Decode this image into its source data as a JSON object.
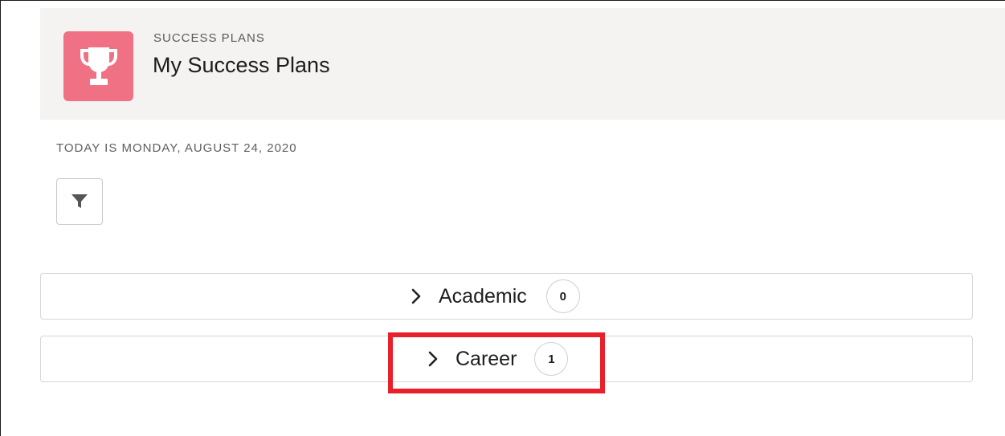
{
  "colors": {
    "app_icon_bg": "#f07183",
    "header_bg": "#f4f3f2",
    "highlight": "#e8202c"
  },
  "header": {
    "icon": "trophy-icon",
    "eyebrow": "SUCCESS PLANS",
    "title": "My Success Plans"
  },
  "today_text": "TODAY IS MONDAY, AUGUST 24, 2020",
  "filter_button": {
    "icon": "filter-icon"
  },
  "sections": [
    {
      "label": "Academic",
      "count": "0",
      "icon": "chevron-right-icon"
    },
    {
      "label": "Career",
      "count": "1",
      "icon": "chevron-right-icon",
      "highlighted": true
    }
  ]
}
